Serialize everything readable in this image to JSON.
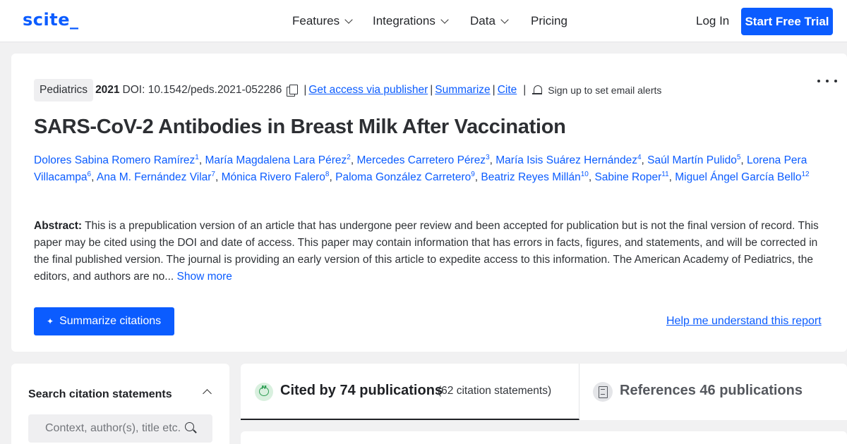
{
  "header": {
    "logo": "scite_",
    "nav": [
      {
        "label": "Features",
        "has_dropdown": true
      },
      {
        "label": "Integrations",
        "has_dropdown": true
      },
      {
        "label": "Data",
        "has_dropdown": true
      },
      {
        "label": "Pricing",
        "has_dropdown": false
      }
    ],
    "login_label": "Log In",
    "trial_label": "Start Free Trial"
  },
  "paper": {
    "subject": "Pediatrics",
    "year": "2021",
    "doi": "DOI: 10.1542/peds.2021-052286",
    "links": {
      "publisher": "Get access via publisher",
      "summarize": "Summarize",
      "cite": "Cite"
    },
    "alerts_label": "Sign up to set email alerts",
    "title": "SARS-CoV-2 Antibodies in Breast Milk After Vaccination",
    "authors": [
      {
        "name": "Dolores Sabina Romero Ramírez",
        "num": "1"
      },
      {
        "name": "María Magdalena Lara Pérez",
        "num": "2"
      },
      {
        "name": "Mercedes Carretero Pérez",
        "num": "3"
      },
      {
        "name": "María Isis Suárez Hernández",
        "num": "4"
      },
      {
        "name": "Saúl Martín Pulido",
        "num": "5"
      },
      {
        "name": "Lorena Pera Villacampa",
        "num": "6"
      },
      {
        "name": "Ana M. Fernández Vilar",
        "num": "7"
      },
      {
        "name": "Mónica Rivero Falero",
        "num": "8"
      },
      {
        "name": "Paloma González Carretero",
        "num": "9"
      },
      {
        "name": "Beatriz Reyes Millán",
        "num": "10"
      },
      {
        "name": "Sabine Roper",
        "num": "11"
      },
      {
        "name": "Miguel Ángel García Bello",
        "num": "12"
      }
    ],
    "abstract_label": "Abstract:",
    "abstract_text": "This is a prepublication version of an article that has undergone peer review and been accepted for publication but is not the final version of record. This paper may be cited using the DOI and date of access. This paper may contain information that has errors in facts, figures, and statements, and will be corrected in the final published version. The journal is providing an early version of this article to expedite access to this information. The American Academy of Pediatrics, the editors, and authors are no...",
    "show_more": "Show more",
    "summarize_btn": "Summarize citations",
    "help_link": "Help me understand this report"
  },
  "search": {
    "title": "Search citation statements",
    "placeholder": "Context, author(s), title etc."
  },
  "tabs": {
    "cited_label": "Cited by 74 publications",
    "cited_sub": "(62 citation statements)",
    "refs_label": "References 46 publications"
  },
  "colors": {
    "brand": "#0b5cff",
    "background": "#f1f1f2",
    "cite_green": "#2e9e54"
  }
}
